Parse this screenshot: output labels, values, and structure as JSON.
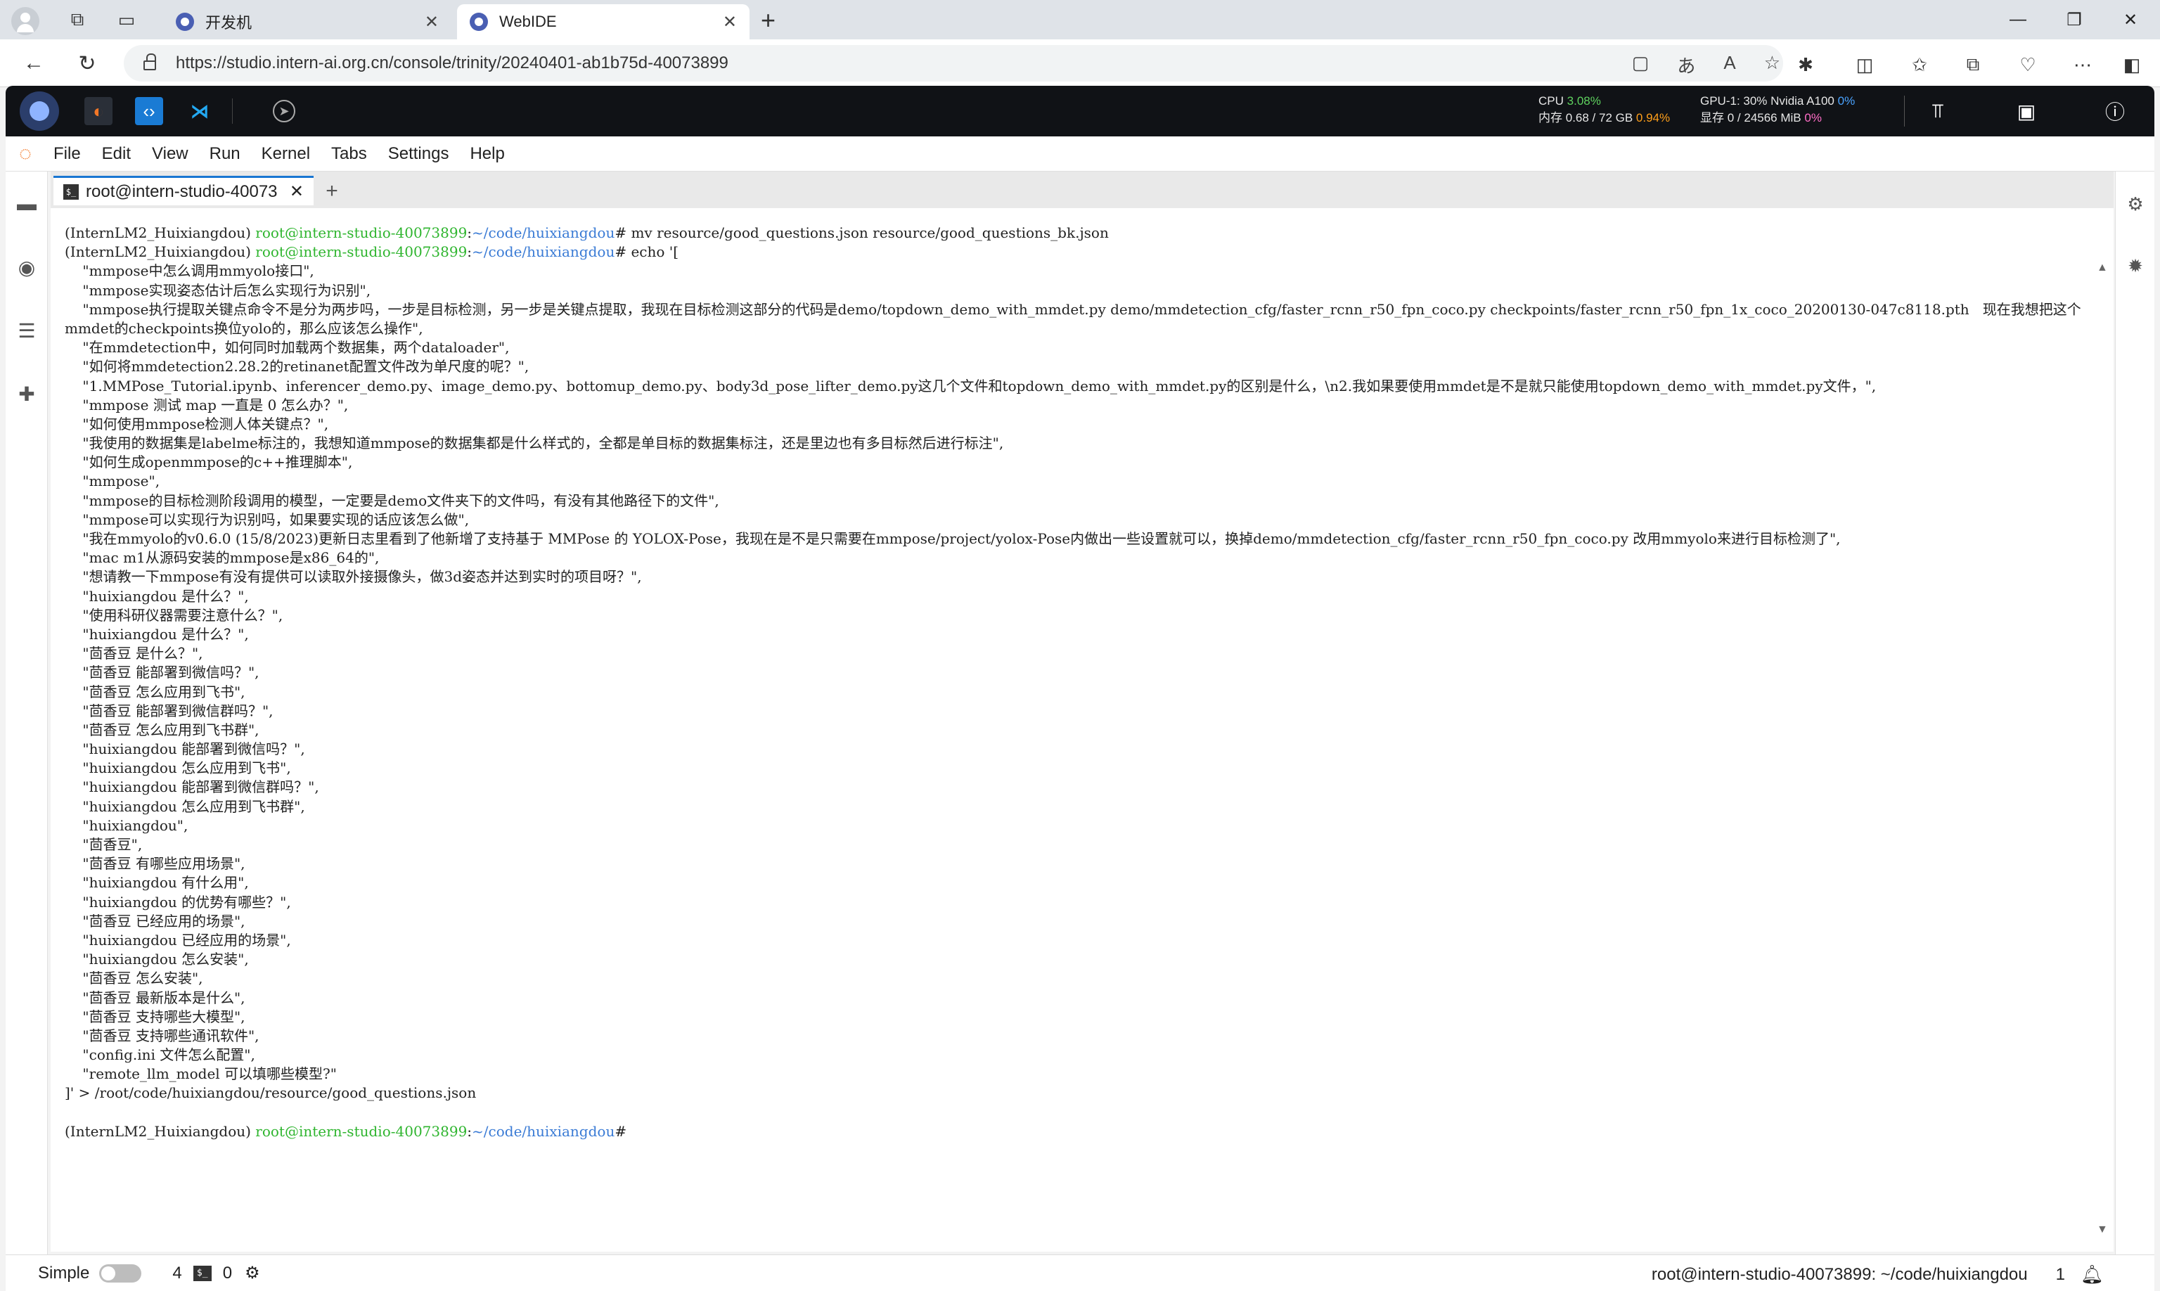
{
  "browser": {
    "tabs": [
      {
        "label": "开发机",
        "active": false
      },
      {
        "label": "WebIDE",
        "active": true
      }
    ],
    "url": "https://studio.intern-ai.org.cn/console/trinity/20240401-ab1b75d-40073899"
  },
  "app": {
    "stats": {
      "cpu_label": "CPU",
      "cpu_value": "3.08%",
      "mem_label": "内存",
      "mem_value": "0.68 / 72 GB",
      "mem_percent": "0.94%",
      "gpu_label": "GPU-1: 30% Nvidia A100",
      "gpu_percent": "0%",
      "vram_label": "显存",
      "vram_value": "0 / 24566 MiB",
      "vram_percent": "0%"
    }
  },
  "menu": [
    "File",
    "Edit",
    "View",
    "Run",
    "Kernel",
    "Tabs",
    "Settings",
    "Help"
  ],
  "doc_tab": {
    "label": "root@intern-studio-40073",
    "term_icon": "$_"
  },
  "terminal": {
    "prompt_env": "(InternLM2_Huixiangdou)",
    "prompt_user": "root@intern-studio-40073899",
    "prompt_path": "~/code/huixiangdou",
    "cmd1": "# mv resource/good_questions.json resource/good_questions_bk.json",
    "cmd2": "# echo '[",
    "lines": [
      "    \"mmpose中怎么调用mmyolo接口\",",
      "    \"mmpose实现姿态估计后怎么实现行为识别\",",
      "    \"mmpose执行提取关键点命令不是分为两步吗，一步是目标检测，另一步是关键点提取，我现在目标检测这部分的代码是demo/topdown_demo_with_mmdet.py demo/mmdetection_cfg/faster_rcnn_r50_fpn_coco.py checkpoints/faster_rcnn_r50_fpn_1x_coco_20200130-047c8118.pth   现在我想把这个mmdet的checkpoints换位yolo的，那么应该怎么操作\",",
      "    \"在mmdetection中，如何同时加载两个数据集，两个dataloader\",",
      "    \"如何将mmdetection2.28.2的retinanet配置文件改为单尺度的呢？\",",
      "    \"1.MMPose_Tutorial.ipynb、inferencer_demo.py、image_demo.py、bottomup_demo.py、body3d_pose_lifter_demo.py这几个文件和topdown_demo_with_mmdet.py的区别是什么，\\n2.我如果要使用mmdet是不是就只能使用topdown_demo_with_mmdet.py文件，\",",
      "    \"mmpose 测试 map 一直是 0 怎么办？\",",
      "    \"如何使用mmpose检测人体关键点？\",",
      "    \"我使用的数据集是labelme标注的，我想知道mmpose的数据集都是什么样式的，全都是单目标的数据集标注，还是里边也有多目标然后进行标注\",",
      "    \"如何生成openmmpose的c++推理脚本\",",
      "    \"mmpose\",",
      "    \"mmpose的目标检测阶段调用的模型，一定要是demo文件夹下的文件吗，有没有其他路径下的文件\",",
      "    \"mmpose可以实现行为识别吗，如果要实现的话应该怎么做\",",
      "    \"我在mmyolo的v0.6.0 (15/8/2023)更新日志里看到了他新增了支持基于 MMPose 的 YOLOX-Pose，我现在是不是只需要在mmpose/project/yolox-Pose内做出一些设置就可以，换掉demo/mmdetection_cfg/faster_rcnn_r50_fpn_coco.py 改用mmyolo来进行目标检测了\",",
      "    \"mac m1从源码安装的mmpose是x86_64的\",",
      "    \"想请教一下mmpose有没有提供可以读取外接摄像头，做3d姿态并达到实时的项目呀？\",",
      "    \"huixiangdou 是什么？\",",
      "    \"使用科研仪器需要注意什么？\",",
      "    \"huixiangdou 是什么？\",",
      "    \"茴香豆 是什么？\",",
      "    \"茴香豆 能部署到微信吗？\",",
      "    \"茴香豆 怎么应用到飞书\",",
      "    \"茴香豆 能部署到微信群吗？\",",
      "    \"茴香豆 怎么应用到飞书群\",",
      "    \"huixiangdou 能部署到微信吗？\",",
      "    \"huixiangdou 怎么应用到飞书\",",
      "    \"huixiangdou 能部署到微信群吗？\",",
      "    \"huixiangdou 怎么应用到飞书群\",",
      "    \"huixiangdou\",",
      "    \"茴香豆\",",
      "    \"茴香豆 有哪些应用场景\",",
      "    \"huixiangdou 有什么用\",",
      "    \"huixiangdou 的优势有哪些？\",",
      "    \"茴香豆 已经应用的场景\",",
      "    \"huixiangdou 已经应用的场景\",",
      "    \"huixiangdou 怎么安装\",",
      "    \"茴香豆 怎么安装\",",
      "    \"茴香豆 最新版本是什么\",",
      "    \"茴香豆 支持哪些大模型\",",
      "    \"茴香豆 支持哪些通讯软件\",",
      "    \"config.ini 文件怎么配置\",",
      "    \"remote_llm_model 可以填哪些模型?\"",
      "]' > /root/code/huixiangdou/resource/good_questions.json"
    ],
    "final_prompt_suffix": "#"
  },
  "status": {
    "mode_label": "Simple",
    "count_a": "4",
    "count_b": "0",
    "terminal_path": "root@intern-studio-40073899: ~/code/huixiangdou",
    "notification_count": "1"
  }
}
